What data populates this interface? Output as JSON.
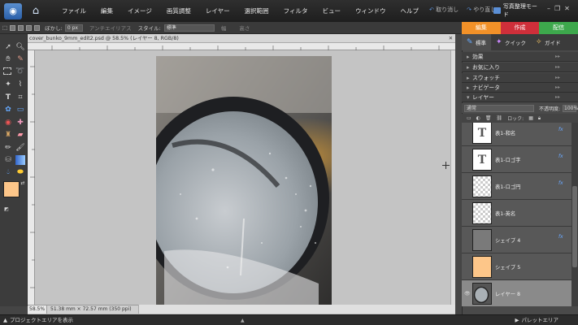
{
  "menubar": {
    "items": [
      "ファイル",
      "編集",
      "イメージ",
      "画質調整",
      "レイヤー",
      "選択範囲",
      "フィルタ",
      "ビュー",
      "ウィンドウ",
      "ヘルプ"
    ],
    "undo_label": "取り消し",
    "redo_label": "やり直し",
    "organizer_label": "写真整理モード"
  },
  "options_bar": {
    "feather_label": "ぼかし:",
    "feather_value": "0 px",
    "antialias_label": "アンチエイリアス",
    "style_label": "スタイル:",
    "style_value": "標準",
    "width_label": "幅",
    "height_label": "高さ"
  },
  "mode_tabs": [
    {
      "label": "編集",
      "color": "#f29128"
    },
    {
      "label": "作成",
      "color": "#cf2f3a"
    },
    {
      "label": "配信",
      "color": "#3da84c"
    }
  ],
  "document": {
    "title": "cover_bunko_9mm_edit2.psd @ 58.5% (レイヤー 8, RGB/8)",
    "zoom": "58.5%",
    "size_info": "51.38 mm × 72.57 mm (350 ppi)"
  },
  "panel_tabs": [
    "標準",
    "クイック",
    "ガイド"
  ],
  "panels": [
    "効果",
    "お気に入り",
    "スウォッチ",
    "ナビゲータ",
    "レイヤー"
  ],
  "layers_panel": {
    "blend_mode": "通常",
    "opacity_label": "不透明度:",
    "opacity_value": "100%",
    "lock_label": "ロック:"
  },
  "layers": [
    {
      "name": "表1-和名",
      "thumb": "text",
      "fx": "fx"
    },
    {
      "name": "表1-ロゴ字",
      "thumb": "text",
      "fx": "fx"
    },
    {
      "name": "表1-ロゴ円",
      "thumb": "checker",
      "fx": "fx"
    },
    {
      "name": "表1-英名",
      "thumb": "checker",
      "fx": ""
    },
    {
      "name": "シェイプ 4",
      "thumb": "gray",
      "fx": "fx"
    },
    {
      "name": "シェイプ 5",
      "thumb": "peach",
      "fx": ""
    },
    {
      "name": "レイヤー 8",
      "thumb": "photo",
      "fx": ""
    }
  ],
  "bottom_bar": {
    "project_bin_label": "プロジェクトエリアを表示",
    "palette_bin_label": "パレットエリア"
  },
  "colors": {
    "foreground": "#fdc689",
    "background": "#000000"
  }
}
